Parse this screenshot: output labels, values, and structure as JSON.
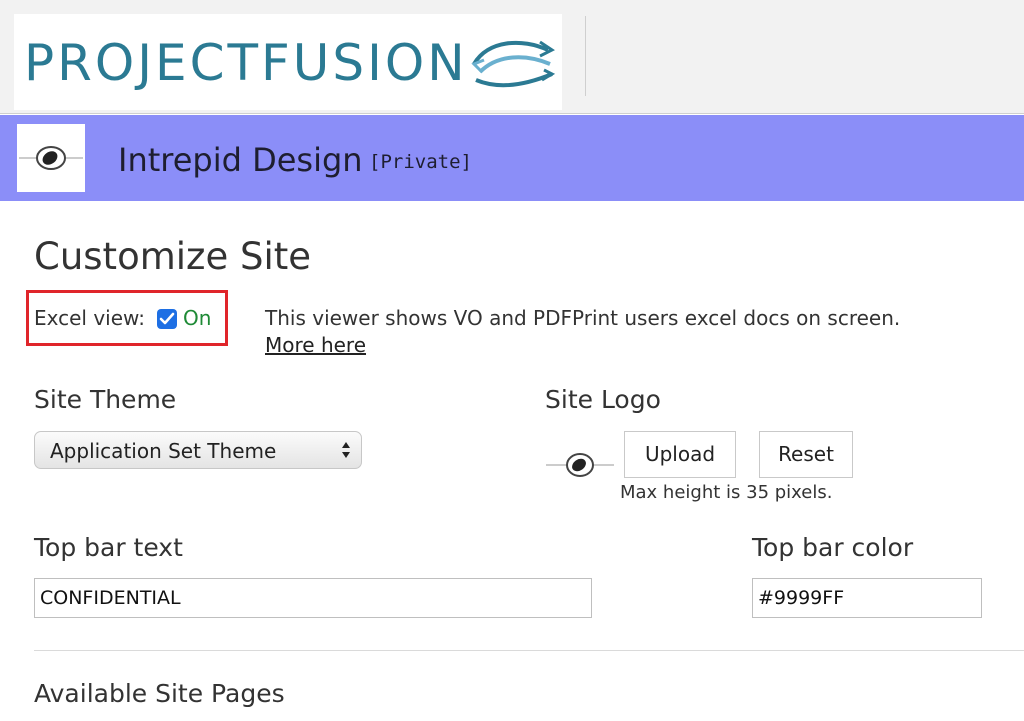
{
  "header": {
    "logo_text": "PROJECTFUSION",
    "logo_icon": "projectfusion-swirl-icon",
    "brand_color": "#2b7a93"
  },
  "site_bar": {
    "title": "Intrepid Design",
    "privacy": "[Private]",
    "bar_color": "#8b8ef8",
    "thumb_icon": "site-logo-thumbnail"
  },
  "page": {
    "title": "Customize Site"
  },
  "excel_view": {
    "label": "Excel view:",
    "checked": true,
    "state_text": "On",
    "description": "This viewer shows VO and PDFPrint users excel docs on screen.",
    "more_link": "More here",
    "highlight_color": "#e0252a"
  },
  "site_theme": {
    "label": "Site Theme",
    "selected": "Application Set Theme"
  },
  "site_logo": {
    "label": "Site Logo",
    "upload_label": "Upload",
    "reset_label": "Reset",
    "hint": "Max height is 35 pixels."
  },
  "top_bar_text": {
    "label": "Top bar text",
    "value": "CONFIDENTIAL"
  },
  "top_bar_color": {
    "label": "Top bar color",
    "value": "#9999FF"
  },
  "available_pages": {
    "label": "Available Site Pages"
  }
}
